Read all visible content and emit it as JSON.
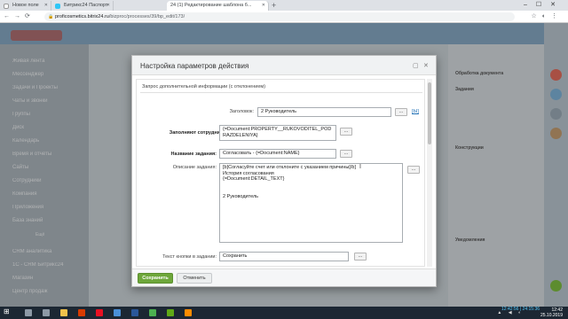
{
  "browser": {
    "tabs": [
      {
        "label": "Новое поле",
        "active": false
      },
      {
        "label": "Битрикс24 Паспорт",
        "active": false
      },
      {
        "label": "24 (1) Редактирование шаблона б...",
        "active": true
      }
    ],
    "url_host": "proficosmetics.bitrix24.ru",
    "url_path": "/bizproc/processes/39/bp_edit/173/"
  },
  "sidebar": {
    "items": [
      "Живая лента",
      "Мессенджер",
      "Задачи и Проекты",
      "Чаты и звонки",
      "Группы",
      "Диск",
      "Календарь",
      "Время и отчёты",
      "Сайты",
      "Сотрудники",
      "Компания",
      "Приложения",
      "База знаний",
      "Ещё",
      "CRM аналитика",
      "1С - CRM Битрикс24",
      "Магазин",
      "Центр продаж"
    ]
  },
  "right_panel": {
    "heading": "Обработка документа",
    "section_tasks": "Задания",
    "section_constructs": "Конструкции",
    "section_notify": "Уведомления"
  },
  "dialog": {
    "title": "Настройка параметров действия",
    "section_title": "Запрос дополнительной информации (с отклонением)",
    "fields": {
      "header_label": "Заголовок:",
      "header_value": "2 Руководитель",
      "assignees_label": "Заполняют сотрудники:",
      "assignees_value": "{=Document:PROPERTY__RUKOVODITEL_PODRAZDELENIYA}",
      "task_name_label": "Название задания:",
      "task_name_value": "Согласовать - {=Document:NAME}",
      "task_desc_label": "Описание задания:",
      "task_desc_value": "[b]Согласуйте счет или отклоните с указанием причины[/b]\nИстория согласования\n{=Document:DETAIL_TEXT}\n\n\n2 Руководитель",
      "button_text_label": "Текст кнопки в задании:",
      "button_text_value": "Сохранить"
    },
    "dots_label": "...",
    "link_label": "[Ы]",
    "save_button": "Сохранить",
    "cancel_button": "Отменить"
  },
  "taskbar": {
    "clock_time": "12:42",
    "clock_date": "25.10.2019",
    "timer": "12:42:56 | 24:15:36"
  },
  "colors": {
    "save_green": "#6ea73b",
    "bitrix_blue": "#3f79a6",
    "chrome_tab": "#dee1e6"
  }
}
